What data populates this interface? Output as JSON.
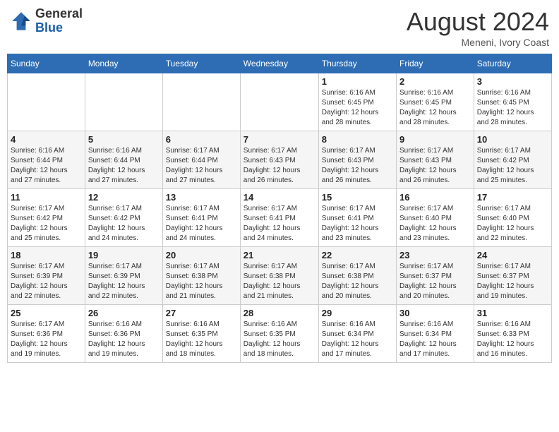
{
  "header": {
    "logo_line1": "General",
    "logo_line2": "Blue",
    "month_year": "August 2024",
    "location": "Meneni, Ivory Coast"
  },
  "weekdays": [
    "Sunday",
    "Monday",
    "Tuesday",
    "Wednesday",
    "Thursday",
    "Friday",
    "Saturday"
  ],
  "weeks": [
    [
      {
        "day": "",
        "info": ""
      },
      {
        "day": "",
        "info": ""
      },
      {
        "day": "",
        "info": ""
      },
      {
        "day": "",
        "info": ""
      },
      {
        "day": "1",
        "info": "Sunrise: 6:16 AM\nSunset: 6:45 PM\nDaylight: 12 hours\nand 28 minutes."
      },
      {
        "day": "2",
        "info": "Sunrise: 6:16 AM\nSunset: 6:45 PM\nDaylight: 12 hours\nand 28 minutes."
      },
      {
        "day": "3",
        "info": "Sunrise: 6:16 AM\nSunset: 6:45 PM\nDaylight: 12 hours\nand 28 minutes."
      }
    ],
    [
      {
        "day": "4",
        "info": "Sunrise: 6:16 AM\nSunset: 6:44 PM\nDaylight: 12 hours\nand 27 minutes."
      },
      {
        "day": "5",
        "info": "Sunrise: 6:16 AM\nSunset: 6:44 PM\nDaylight: 12 hours\nand 27 minutes."
      },
      {
        "day": "6",
        "info": "Sunrise: 6:17 AM\nSunset: 6:44 PM\nDaylight: 12 hours\nand 27 minutes."
      },
      {
        "day": "7",
        "info": "Sunrise: 6:17 AM\nSunset: 6:43 PM\nDaylight: 12 hours\nand 26 minutes."
      },
      {
        "day": "8",
        "info": "Sunrise: 6:17 AM\nSunset: 6:43 PM\nDaylight: 12 hours\nand 26 minutes."
      },
      {
        "day": "9",
        "info": "Sunrise: 6:17 AM\nSunset: 6:43 PM\nDaylight: 12 hours\nand 26 minutes."
      },
      {
        "day": "10",
        "info": "Sunrise: 6:17 AM\nSunset: 6:42 PM\nDaylight: 12 hours\nand 25 minutes."
      }
    ],
    [
      {
        "day": "11",
        "info": "Sunrise: 6:17 AM\nSunset: 6:42 PM\nDaylight: 12 hours\nand 25 minutes."
      },
      {
        "day": "12",
        "info": "Sunrise: 6:17 AM\nSunset: 6:42 PM\nDaylight: 12 hours\nand 24 minutes."
      },
      {
        "day": "13",
        "info": "Sunrise: 6:17 AM\nSunset: 6:41 PM\nDaylight: 12 hours\nand 24 minutes."
      },
      {
        "day": "14",
        "info": "Sunrise: 6:17 AM\nSunset: 6:41 PM\nDaylight: 12 hours\nand 24 minutes."
      },
      {
        "day": "15",
        "info": "Sunrise: 6:17 AM\nSunset: 6:41 PM\nDaylight: 12 hours\nand 23 minutes."
      },
      {
        "day": "16",
        "info": "Sunrise: 6:17 AM\nSunset: 6:40 PM\nDaylight: 12 hours\nand 23 minutes."
      },
      {
        "day": "17",
        "info": "Sunrise: 6:17 AM\nSunset: 6:40 PM\nDaylight: 12 hours\nand 22 minutes."
      }
    ],
    [
      {
        "day": "18",
        "info": "Sunrise: 6:17 AM\nSunset: 6:39 PM\nDaylight: 12 hours\nand 22 minutes."
      },
      {
        "day": "19",
        "info": "Sunrise: 6:17 AM\nSunset: 6:39 PM\nDaylight: 12 hours\nand 22 minutes."
      },
      {
        "day": "20",
        "info": "Sunrise: 6:17 AM\nSunset: 6:38 PM\nDaylight: 12 hours\nand 21 minutes."
      },
      {
        "day": "21",
        "info": "Sunrise: 6:17 AM\nSunset: 6:38 PM\nDaylight: 12 hours\nand 21 minutes."
      },
      {
        "day": "22",
        "info": "Sunrise: 6:17 AM\nSunset: 6:38 PM\nDaylight: 12 hours\nand 20 minutes."
      },
      {
        "day": "23",
        "info": "Sunrise: 6:17 AM\nSunset: 6:37 PM\nDaylight: 12 hours\nand 20 minutes."
      },
      {
        "day": "24",
        "info": "Sunrise: 6:17 AM\nSunset: 6:37 PM\nDaylight: 12 hours\nand 19 minutes."
      }
    ],
    [
      {
        "day": "25",
        "info": "Sunrise: 6:17 AM\nSunset: 6:36 PM\nDaylight: 12 hours\nand 19 minutes."
      },
      {
        "day": "26",
        "info": "Sunrise: 6:16 AM\nSunset: 6:36 PM\nDaylight: 12 hours\nand 19 minutes."
      },
      {
        "day": "27",
        "info": "Sunrise: 6:16 AM\nSunset: 6:35 PM\nDaylight: 12 hours\nand 18 minutes."
      },
      {
        "day": "28",
        "info": "Sunrise: 6:16 AM\nSunset: 6:35 PM\nDaylight: 12 hours\nand 18 minutes."
      },
      {
        "day": "29",
        "info": "Sunrise: 6:16 AM\nSunset: 6:34 PM\nDaylight: 12 hours\nand 17 minutes."
      },
      {
        "day": "30",
        "info": "Sunrise: 6:16 AM\nSunset: 6:34 PM\nDaylight: 12 hours\nand 17 minutes."
      },
      {
        "day": "31",
        "info": "Sunrise: 6:16 AM\nSunset: 6:33 PM\nDaylight: 12 hours\nand 16 minutes."
      }
    ]
  ]
}
